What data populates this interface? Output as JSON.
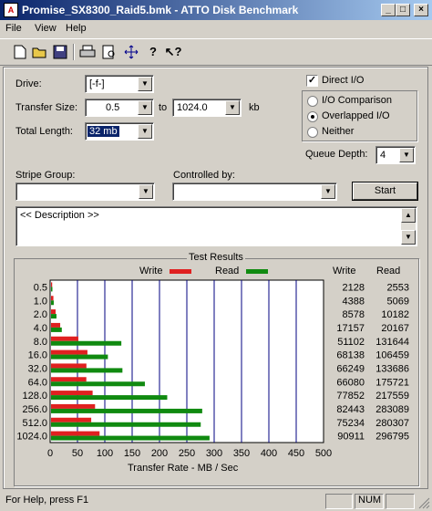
{
  "window": {
    "title": "Promise_SX8300_Raid5.bmk - ATTO Disk Benchmark",
    "minimize": "_",
    "maximize": "□",
    "close": "×"
  },
  "menu": [
    "File",
    "View",
    "Help"
  ],
  "toolbar": {
    "icons": [
      "new-icon",
      "open-icon",
      "save-icon",
      "print-icon",
      "print-preview-icon",
      "move-icon",
      "help-icon",
      "context-help-icon"
    ]
  },
  "form": {
    "drive_label": "Drive:",
    "drive_value": "[-f-]",
    "transfer_size_label": "Transfer Size:",
    "transfer_from": "0.5",
    "to_label": "to",
    "transfer_to": "1024.0",
    "kb_label": "kb",
    "total_length_label": "Total Length:",
    "total_length_value": "32 mb",
    "direct_io_label": "Direct I/O",
    "direct_io_checked": true,
    "io_comparison_label": "I/O Comparison",
    "overlapped_io_label": "Overlapped I/O",
    "neither_label": "Neither",
    "selected_io_mode": "Overlapped I/O",
    "queue_depth_label": "Queue Depth:",
    "queue_depth_value": "4",
    "stripe_group_label": "Stripe Group:",
    "stripe_group_value": "",
    "controlled_by_label": "Controlled by:",
    "controlled_by_value": "",
    "start_button": "Start",
    "description": "<< Description >>"
  },
  "results": {
    "title": "Test Results",
    "write_legend": "Write",
    "read_legend": "Read",
    "write_col": "Write",
    "read_col": "Read",
    "write_color": "#e02020",
    "read_color": "#108a10",
    "xlabel": "Transfer Rate - MB / Sec"
  },
  "chart_data": {
    "type": "bar",
    "orientation": "horizontal",
    "title": "Test Results",
    "xlabel": "Transfer Rate - MB / Sec",
    "xlim": [
      0,
      500
    ],
    "xticks": [
      "0",
      "50",
      "100",
      "150",
      "200",
      "250",
      "300",
      "350",
      "400",
      "450",
      "500"
    ],
    "categories": [
      "0.5",
      "1.0",
      "2.0",
      "4.0",
      "8.0",
      "16.0",
      "32.0",
      "64.0",
      "128.0",
      "256.0",
      "512.0",
      "1024.0"
    ],
    "series": [
      {
        "name": "Write",
        "values": [
          2128,
          4388,
          8578,
          17157,
          51102,
          68138,
          66249,
          66080,
          77852,
          82443,
          75234,
          90911
        ]
      },
      {
        "name": "Read",
        "values": [
          2553,
          5069,
          10182,
          20167,
          131644,
          106459,
          133686,
          175721,
          217559,
          283089,
          280307,
          296795
        ]
      }
    ],
    "value_unit_note": "KB/s values printed in columns; bar length in MB/s"
  },
  "status": {
    "help_text": "For Help, press F1",
    "num": "NUM"
  }
}
